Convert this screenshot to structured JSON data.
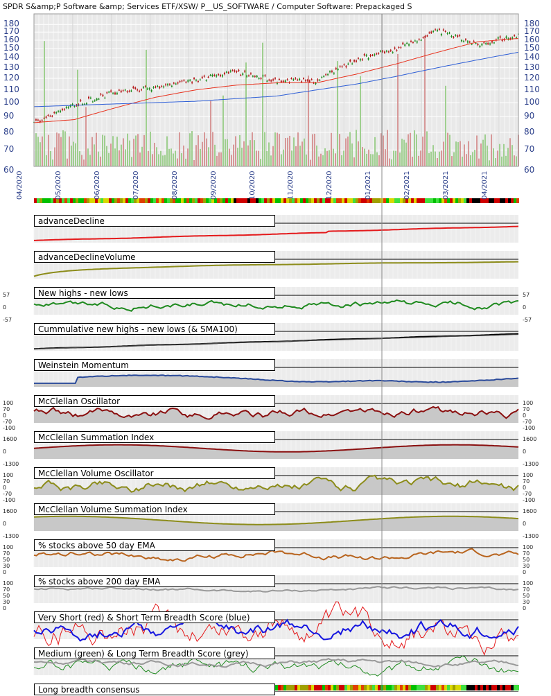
{
  "title": "SPDR S&amp;P Software &amp; Services ETF/XSW/ P__US_SOFTWARE / Computer Software: Prepackaged S",
  "colors": {
    "price_up": "#1a8a1a",
    "price_down": "#b31414",
    "sma_red": "#e8321e",
    "sma_blue": "#2f5fd6",
    "vol_up": "#9fcf8f",
    "vol_down": "#d79898",
    "advanceDecline": "#e41a1c",
    "advanceDeclineVolume": "#8c8c1a",
    "newhighs": "#1f8a1f",
    "weinstein": "#2a4a9a",
    "mcclellan": "#8a1010",
    "olive": "#8c8c1a",
    "ema50": "#b8641e",
    "ema200": "#999999",
    "vshort": "#e41a1c",
    "short": "#1515e0",
    "medium": "#1f8a1f",
    "long": "#999999"
  },
  "main_chart": {
    "y_ticks": [
      "180",
      "170",
      "160",
      "150",
      "140",
      "130",
      "120",
      "110",
      "100",
      "90",
      "80",
      "70",
      "60"
    ],
    "x_ticks": [
      "04/2020",
      "05/2020",
      "06/2020",
      "07/2020",
      "08/2020",
      "09/2020",
      "10/2020",
      "11/2020",
      "12/2020",
      "01/2021",
      "02/2021",
      "03/2021",
      "04/2021"
    ]
  },
  "panels": [
    {
      "label": "advanceDecline"
    },
    {
      "label": "advanceDeclineVolume"
    },
    {
      "label": "New highs - new lows",
      "ticks": [
        "57",
        "0",
        "-57"
      ]
    },
    {
      "label": "Cummulative new highs - new lows (& SMA100)"
    },
    {
      "label": "Weinstein Momentum"
    },
    {
      "label": "McClellan Oscillator",
      "ticks": [
        "100",
        "70",
        "0",
        "-70",
        "-100"
      ]
    },
    {
      "label": "McClellan Summation Index",
      "ticks": [
        "1600",
        "0",
        "-1300"
      ]
    },
    {
      "label": "McClellan Volume Oscillator",
      "ticks": [
        "100",
        "70",
        "0",
        "-70",
        "-100"
      ]
    },
    {
      "label": "McClellan Volume Summation Index",
      "ticks": [
        "1600",
        "0",
        "-1300"
      ]
    },
    {
      "label": "% stocks above 50 day EMA",
      "ticks": [
        "100",
        "70",
        "50",
        "30",
        "0"
      ]
    },
    {
      "label": "% stocks above 200 day EMA",
      "ticks": [
        "100",
        "70",
        "50",
        "30",
        "0"
      ]
    },
    {
      "label": "Very Short (red) & Short Term Breadth Score (blue)"
    },
    {
      "label": "Medium (green) & Long Term Breadth Score (grey)"
    },
    {
      "label": "Long breadth consensus"
    }
  ],
  "chart_data": {
    "type": "line",
    "title": "SPDR S&amp;P Software &amp; Services ETF/XSW/ P__US_SOFTWARE / Computer Software: Prepackaged S",
    "x": [
      "04/2020",
      "05/2020",
      "06/2020",
      "07/2020",
      "08/2020",
      "09/2020",
      "10/2020",
      "11/2020",
      "12/2020",
      "01/2021",
      "02/2021",
      "03/2021",
      "04/2021"
    ],
    "ylim": [
      60,
      185
    ],
    "y_scale": "log",
    "series": [
      {
        "values": [
          86,
          98,
          108,
          112,
          118,
          126,
          118,
          118,
          138,
          150,
          172,
          155,
          166
        ]
      },
      {
        "values": [
          86,
          88,
          96,
          104,
          110,
          114,
          116,
          116,
          124,
          134,
          146,
          158,
          162
        ]
      },
      {
        "values": [
          97,
          98,
          99,
          100,
          101,
          103,
          105,
          110,
          115,
          122,
          130,
          138,
          146
        ]
      }
    ]
  }
}
